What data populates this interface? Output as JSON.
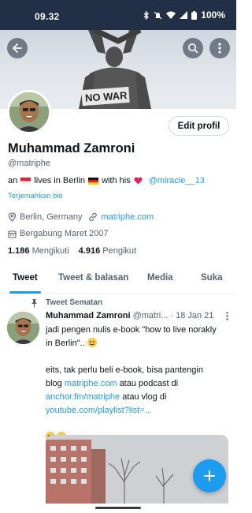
{
  "status_bar": {
    "time": "09.32",
    "battery": "100%",
    "icons": [
      "bluetooth-icon",
      "mute-icon",
      "wifi-icon",
      "signal-icon",
      "battery-icon"
    ]
  },
  "header": {
    "buttons": [
      "back-arrow-icon",
      "search-icon",
      "more-vertical-icon"
    ],
    "banner_text": "NO WAR"
  },
  "profile": {
    "edit_button": "Edit profil",
    "name": "Muhammad Zamroni",
    "handle": "@matriphe",
    "bio": {
      "part1": "an",
      "part2": "lives in Berlin",
      "part3": "with his",
      "mention": "@miracle__13"
    },
    "translate_label": "Terjemahkan bio",
    "location": "Berlin, Germany",
    "website": "matriphe.com",
    "joined": "Bergabung Maret 2007",
    "following_count": "1.186",
    "following_label": "Mengikuti",
    "followers_count": "4.916",
    "followers_label": "Pengikut"
  },
  "tabs": [
    {
      "label": "Tweet",
      "active": true
    },
    {
      "label": "Tweet & balasan",
      "active": false
    },
    {
      "label": "Media",
      "active": false
    },
    {
      "label": "Suka",
      "active": false
    }
  ],
  "pinned_tweet": {
    "pinned_label": "Tweet Sematan",
    "author_name": "Muhammad Zamroni",
    "author_handle": "@matri...",
    "date": "· 18 Jan 21",
    "line1": "jadi pengen nulis e-book \"how to live norakly",
    "line2_text": "in Berlin\"..",
    "line3": "eits, tak perlu beli e-book, bisa pantengin",
    "line4_pre": "blog",
    "line4_link": "matriphe.com",
    "line4_post": "atau podcast di",
    "line5_link": "anchor.fm/matriphe",
    "line5_post": "atau vlog di",
    "line6_link": "youtube.com/playlist?list=..."
  },
  "fab": {
    "icon": "plus-icon"
  },
  "colors": {
    "accent": "#1d9bf0",
    "status_bar": "#223047",
    "text_primary": "#0f1419",
    "text_secondary": "#536471"
  }
}
